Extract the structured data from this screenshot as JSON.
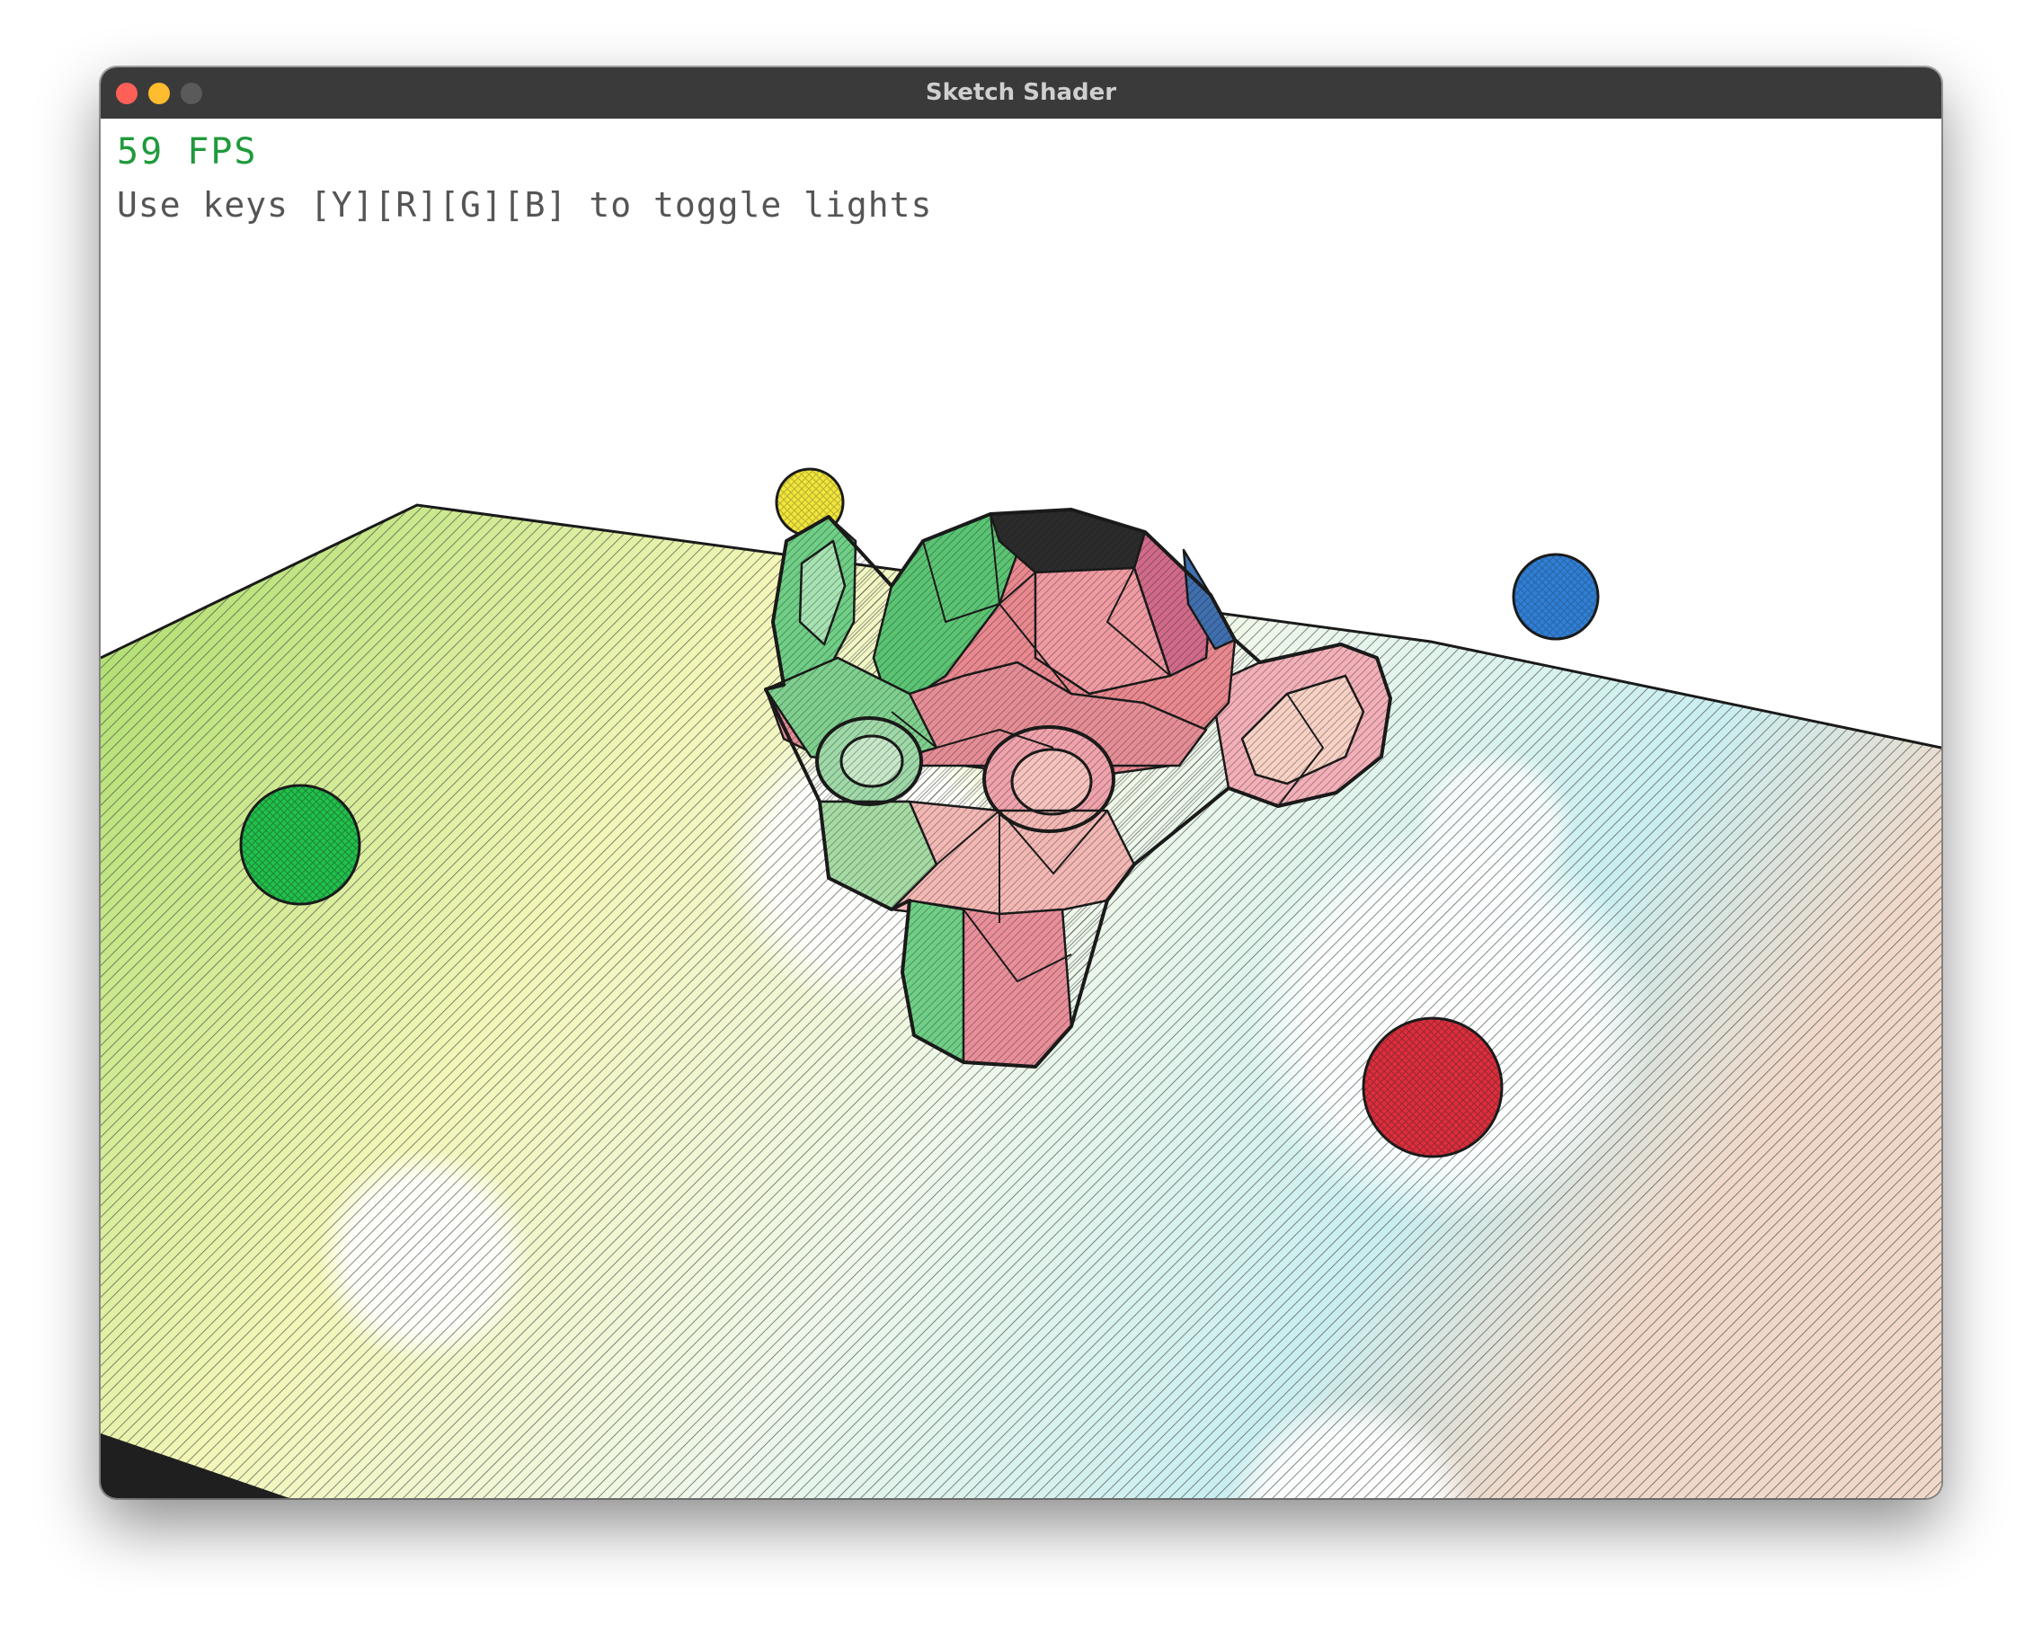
{
  "window": {
    "title": "Sketch Shader",
    "buttons": {
      "close_color": "#fe5f57",
      "minimize_color": "#febc2e",
      "zoom_color": "#5a5a5a"
    }
  },
  "hud": {
    "fps_text": "59 FPS",
    "help_text": "Use keys [Y][R][G][B] to toggle lights"
  },
  "scene": {
    "model": "suzanne-monkey-head",
    "lights": [
      {
        "key": "Y",
        "color": "#f2e63a"
      },
      {
        "key": "R",
        "color": "#e02d3c"
      },
      {
        "key": "G",
        "color": "#1fc24a"
      },
      {
        "key": "B",
        "color": "#2f7fd6"
      }
    ]
  }
}
